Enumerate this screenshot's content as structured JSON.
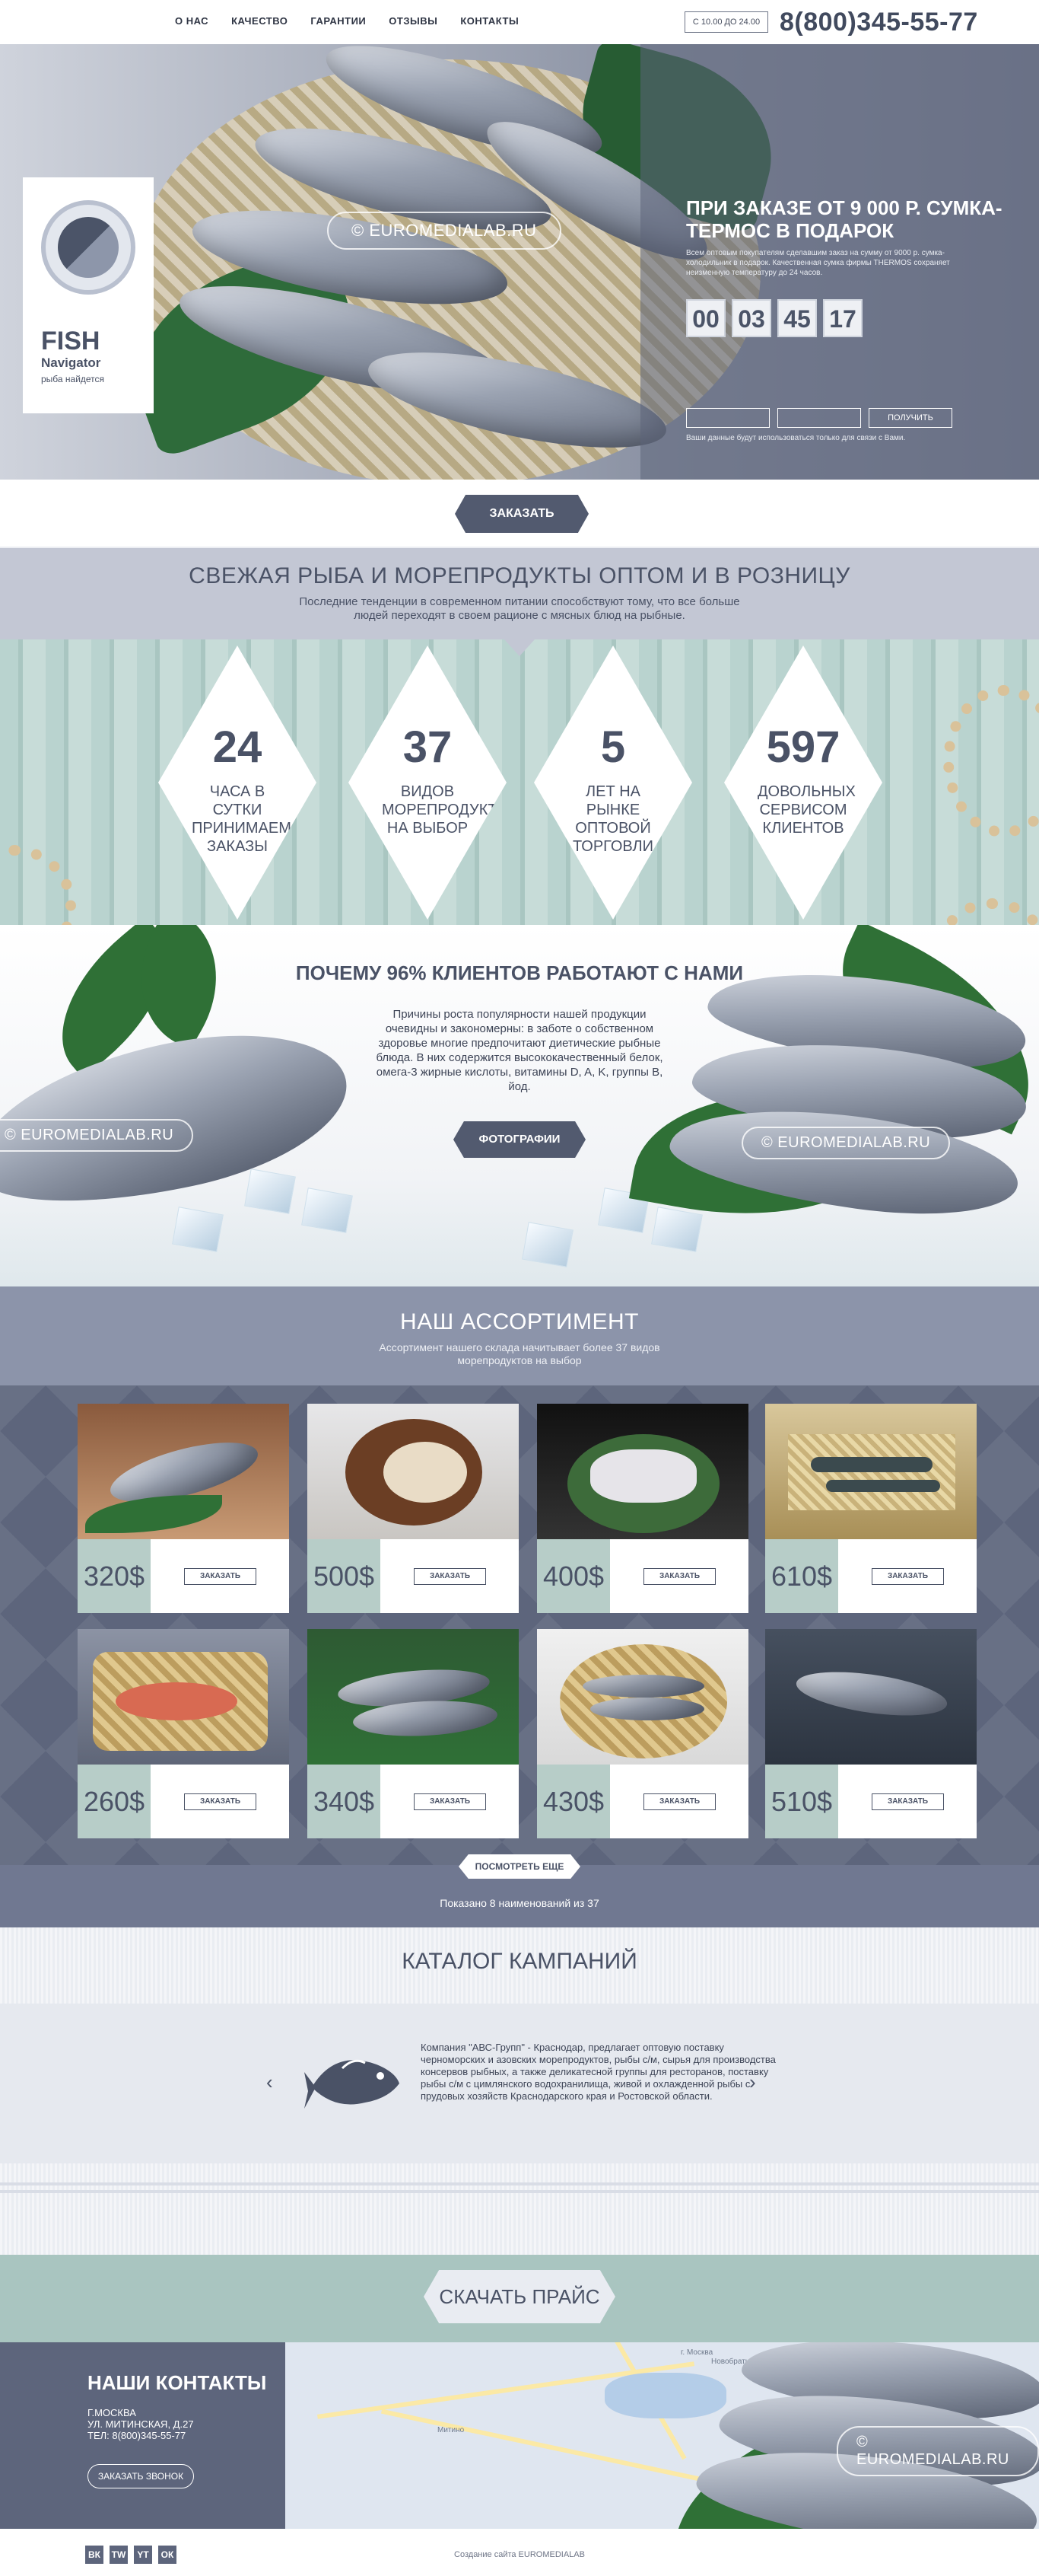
{
  "nav": {
    "items": [
      "О НАС",
      "КАЧЕСТВО",
      "ГАРАНТИИ",
      "ОТЗЫВЫ",
      "КОНТАКТЫ"
    ],
    "hours": "С 10.00 ДО 24.00",
    "phone": "8(800)345-55-77"
  },
  "hero": {
    "logo_title": "FISH",
    "logo_subtitle": "Navigator",
    "logo_tagline": "рыба найдется",
    "watermark": "© EUROMEDIALAB.RU",
    "offer_title": "ПРИ ЗАКАЗЕ ОТ 9 000 Р. СУМКА-ТЕРМОС В ПОДАРОК",
    "offer_text": "Всем оптовым покупателям сделавшим заказ на сумму от 9000 р. сумка-холодильник в подарок. Качественная сумка фирмы THERMOS сохраняет неизменную температуру до 24 часов.",
    "timer": [
      "00",
      "03",
      "45",
      "17"
    ],
    "form_button": "ПОЛУЧИТЬ",
    "form_note": "Ваши данные будут использоваться только для связи с Вами."
  },
  "order_button": "ЗАКАЗАТЬ",
  "fresh": {
    "title": "СВЕЖАЯ РЫБА И МОРЕПРОДУКТЫ ОПТОМ И В РОЗНИЦУ",
    "text": "Последние тенденции в современном питании способствуют тому, что все больше людей переходят в своем рационе с мясных блюд на рыбные."
  },
  "stats": [
    {
      "num": "24",
      "label": "ЧАСА В СУТКИ ПРИНИМАЕМ ЗАКАЗЫ"
    },
    {
      "num": "37",
      "label": "ВИДОВ МОРЕПРОДУКТОВ НА ВЫБОР"
    },
    {
      "num": "5",
      "label": "ЛЕТ НА РЫНКЕ ОПТОВОЙ ТОРГОВЛИ"
    },
    {
      "num": "597",
      "label": "ДОВОЛЬНЫХ СЕРВИСОМ КЛИЕНТОВ"
    }
  ],
  "why": {
    "title": "ПОЧЕМУ 96% КЛИЕНТОВ РАБОТАЮТ С НАМИ",
    "text": "Причины роста популярности нашей продукции очевидны и закономерны: в заботе о собственном здоровье многие предпочитают диетические рыбные блюда. В них содержится высококачественный белок, омега-3 жирные кислоты, витамины D, A, K, группы B, йод.",
    "button": "ФОТОГРАФИИ",
    "watermark": "© EUROMEDIALAB.RU"
  },
  "assortment": {
    "title": "НАШ АССОРТИМЕНТ",
    "text": "Ассортимент нашего склада начитывает более 37 видов морепродуктов на выбор",
    "items": [
      {
        "price": "320$",
        "button": "ЗАКАЗАТЬ"
      },
      {
        "price": "500$",
        "button": "ЗАКАЗАТЬ"
      },
      {
        "price": "400$",
        "button": "ЗАКАЗАТЬ"
      },
      {
        "price": "610$",
        "button": "ЗАКАЗАТЬ"
      },
      {
        "price": "260$",
        "button": "ЗАКАЗАТЬ"
      },
      {
        "price": "340$",
        "button": "ЗАКАЗАТЬ"
      },
      {
        "price": "430$",
        "button": "ЗАКАЗАТЬ"
      },
      {
        "price": "510$",
        "button": "ЗАКАЗАТЬ"
      }
    ],
    "more_button": "ПОСМОТРЕТЬ ЕЩЕ",
    "shown": "Показано 8 наименований из 37"
  },
  "catalog": {
    "title": "КАТАЛОГ КАМПАНИЙ",
    "text": "Компания \"АВС-Групп\" - Краснодар, предлагает оптовую поставку черноморских и азовских морепродуктов, рыбы с/м, сырья для производства консервов рыбных, а также деликатесной группы для ресторанов, поставку рыбы с/м с цимлянского водохранилища, живой и охлажденной рыбы с прудовых хозяйств Краснодарского края и Ростовской области.",
    "prev": "‹",
    "next": "›"
  },
  "download_button": "СКАЧАТЬ ПРАЙС",
  "contacts": {
    "title": "НАШИ КОНТАКТЫ",
    "city": "Г.МОСКВА",
    "address": "УЛ. МИТИНСКАЯ, Д.27",
    "phone": "ТЕЛ: 8(800)345-55-77",
    "call_button": "ЗАКАЗАТЬ ЗВОНОК",
    "map_labels": [
      "г. Москва",
      "Митино",
      "Новобратцевский"
    ],
    "watermark": "© EUROMEDIALAB.RU"
  },
  "footer": {
    "social": [
      "ВК",
      "TW",
      "YT",
      "ОК"
    ],
    "credit": "Создание сайта EUROMEDIALAB"
  }
}
